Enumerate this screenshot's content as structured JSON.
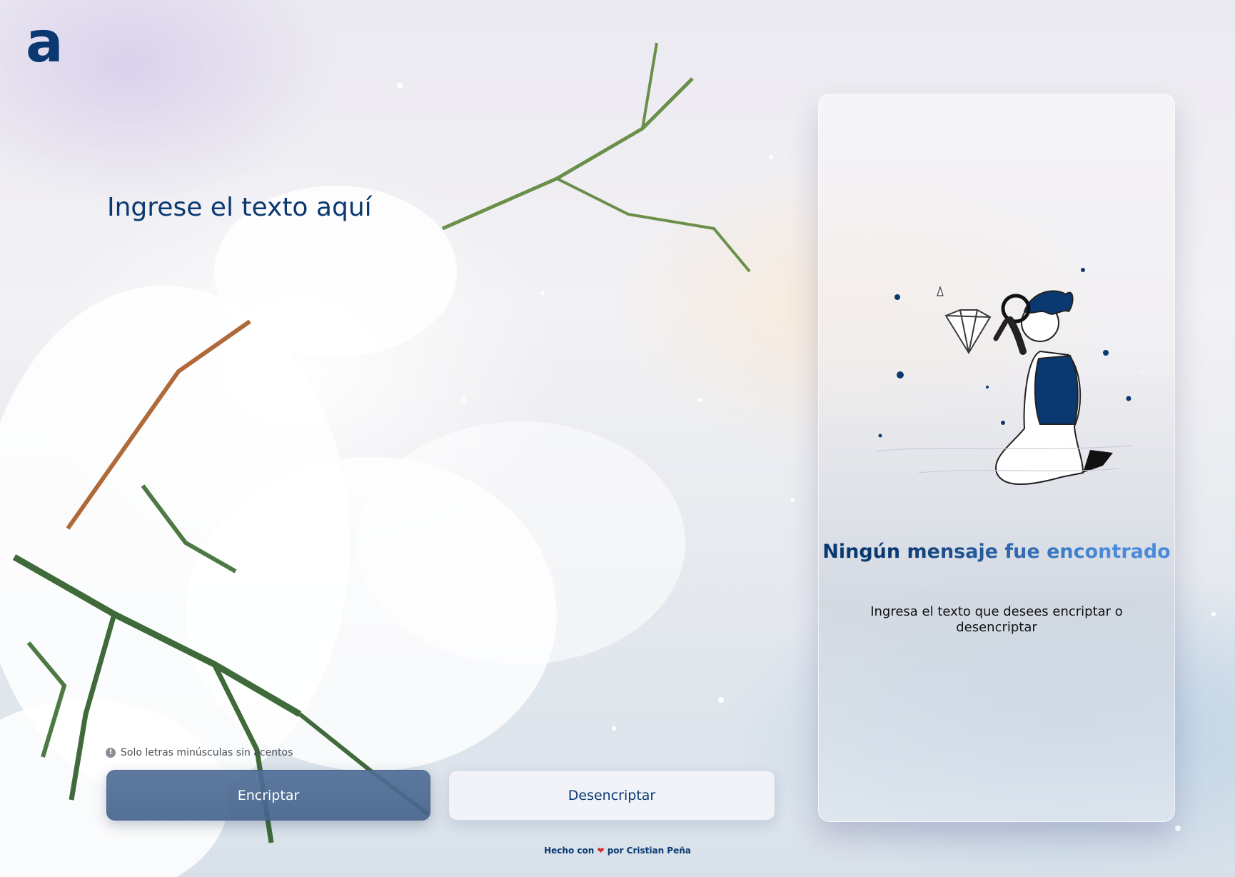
{
  "brand": {
    "logo_letter": "a"
  },
  "input": {
    "placeholder": "Ingrese el texto aquí",
    "value": ""
  },
  "hint": {
    "icon": "info-icon",
    "icon_glyph": "!",
    "text": "Solo letras minúsculas sin acentos"
  },
  "buttons": {
    "encrypt_label": "Encriptar",
    "decrypt_label": "Desencriptar"
  },
  "output": {
    "title": "Ningún mensaje fue encontrado",
    "message": "Ingresa el texto que desees encriptar o desencriptar"
  },
  "footer": {
    "prefix": "Hecho con",
    "heart": "❤",
    "suffix": "por Cristian Peña"
  },
  "colors": {
    "primary": "#0a3871",
    "accent": "#4a8ad8",
    "encrypt_button": "#506e96",
    "heart": "#d32f2f"
  }
}
